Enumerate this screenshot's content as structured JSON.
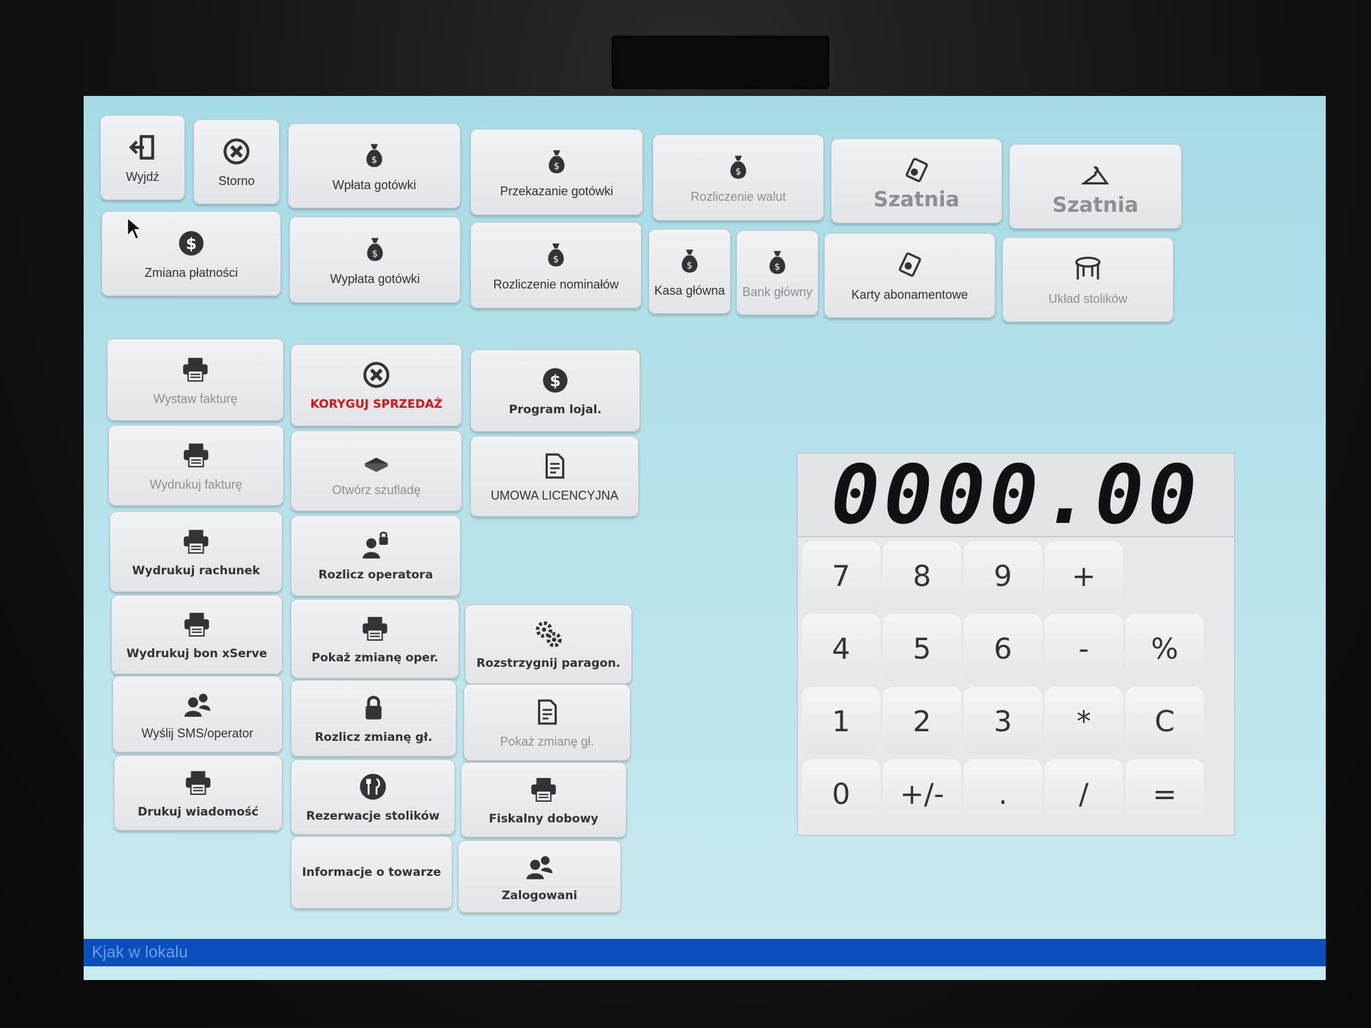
{
  "buttons": [
    {
      "id": "wyjdz",
      "label": "Wyjdź",
      "icon": "exit-icon",
      "style": "normal"
    },
    {
      "id": "storno",
      "label": "Storno",
      "icon": "cancel-circle-icon",
      "style": "normal"
    },
    {
      "id": "wplata-gotowki",
      "label": "Wpłata gotówki",
      "icon": "money-bag-icon",
      "style": "normal"
    },
    {
      "id": "przekazanie-gotowki",
      "label": "Przekazanie gotówki",
      "icon": "money-bag-icon",
      "style": "normal"
    },
    {
      "id": "rozliczenie-walut",
      "label": "Rozliczenie walut",
      "icon": "money-bag-icon",
      "style": "dim"
    },
    {
      "id": "szatnia-1",
      "label": "Szatnia",
      "icon": "cloakroom-ticket-icon",
      "style": "big"
    },
    {
      "id": "szatnia-2",
      "label": "Szatnia",
      "icon": "hanger-icon",
      "style": "big"
    },
    {
      "id": "zmiana-platnosci",
      "label": "Zmiana płatności",
      "icon": "dollar-coin-icon",
      "style": "normal"
    },
    {
      "id": "wyplata-gotowki",
      "label": "Wypłata gotówki",
      "icon": "money-bag-icon",
      "style": "normal"
    },
    {
      "id": "rozliczenie-nominalow",
      "label": "Rozliczenie nominałów",
      "icon": "money-bag-icon",
      "style": "normal"
    },
    {
      "id": "kasa-glowna",
      "label": "Kasa główna",
      "icon": "money-bag-icon",
      "style": "normal"
    },
    {
      "id": "bank-glowny",
      "label": "Bank główny",
      "icon": "money-bag-icon",
      "style": "dim"
    },
    {
      "id": "karty-abonamentowe",
      "label": "Karty abonamentowe",
      "icon": "card-icon",
      "style": "normal"
    },
    {
      "id": "uklad-stolikow",
      "label": "Układ stolików",
      "icon": "table-icon",
      "style": "dim"
    },
    {
      "id": "wystaw-fakture",
      "label": "Wystaw fakturę",
      "icon": "printer-icon",
      "style": "dim"
    },
    {
      "id": "koryguj-sprzedaz",
      "label": "KORYGUJ SPRZEDAŻ",
      "icon": "cancel-circle-icon",
      "style": "red"
    },
    {
      "id": "program-lojal",
      "label": "Program lojal.",
      "icon": "dollar-coin-icon",
      "style": "bold"
    },
    {
      "id": "wydrukuj-fakture",
      "label": "Wydrukuj fakturę",
      "icon": "printer-icon",
      "style": "dim"
    },
    {
      "id": "otworz-szuflade",
      "label": "Otwórz szufladę",
      "icon": "drawer-icon",
      "style": "dim"
    },
    {
      "id": "umowa-licencyjna",
      "label": "UMOWA LICENCYJNA",
      "icon": "document-icon",
      "style": "normal"
    },
    {
      "id": "wydrukuj-rachunek",
      "label": "Wydrukuj rachunek",
      "icon": "printer-icon",
      "style": "bold"
    },
    {
      "id": "rozlicz-operatora",
      "label": "Rozlicz operatora",
      "icon": "user-lock-icon",
      "style": "bold"
    },
    {
      "id": "wydrukuj-bon-xserve",
      "label": "Wydrukuj bon xServe",
      "icon": "printer-icon",
      "style": "bold"
    },
    {
      "id": "pokaz-zmiane-oper",
      "label": "Pokaż zmianę oper.",
      "icon": "printer-icon",
      "style": "bold"
    },
    {
      "id": "rozstrzygnij-paragon",
      "label": "Rozstrzygnij paragon.",
      "icon": "gears-icon",
      "style": "bold"
    },
    {
      "id": "wyslij-sms",
      "label": "Wyślij SMS/operator",
      "icon": "users-icon",
      "style": "normal"
    },
    {
      "id": "rozlicz-zmiane-gl",
      "label": "Rozlicz zmianę gł.",
      "icon": "lock-icon",
      "style": "bold"
    },
    {
      "id": "pokaz-zmiane-gl",
      "label": "Pokaż zmianę gł.",
      "icon": "document-icon",
      "style": "dim"
    },
    {
      "id": "drukuj-wiadomosc",
      "label": "Drukuj wiadomość",
      "icon": "printer-icon",
      "style": "bold"
    },
    {
      "id": "rezerwacje-stolikow",
      "label": "Rezerwacje stolików",
      "icon": "cutlery-icon",
      "style": "bold"
    },
    {
      "id": "fiskalny-dobowy",
      "label": "Fiskalny dobowy",
      "icon": "printer-icon",
      "style": "bold"
    },
    {
      "id": "informacje-o-towarze",
      "label": "Informacje o towarze",
      "icon": "none",
      "style": "bold"
    },
    {
      "id": "zalogowani",
      "label": "Zalogowani",
      "icon": "users-icon",
      "style": "bold"
    }
  ],
  "calculator": {
    "display": "0000.00",
    "keys": [
      "7",
      "8",
      "9",
      "+",
      "4",
      "5",
      "6",
      "-",
      "%",
      "1",
      "2",
      "3",
      "*",
      "C",
      "0",
      "+/-",
      ".",
      "/",
      "="
    ]
  },
  "status_bar": {
    "text": "Kjak w lokalu"
  },
  "colors": {
    "status_bar": "#0b4fbf",
    "danger": "#d61616",
    "screen_bg": "#b6e2ea"
  }
}
